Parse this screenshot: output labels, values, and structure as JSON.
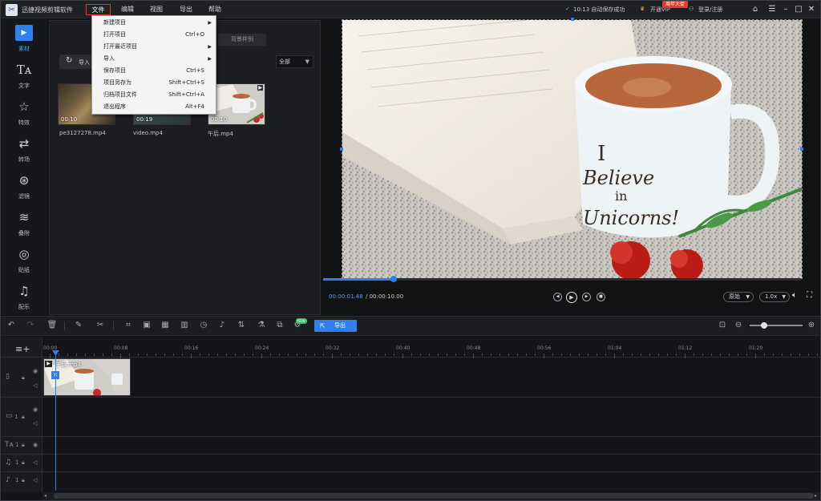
{
  "titlebar": {
    "app_title": "迅捷视频剪辑软件",
    "menu": [
      "文件",
      "编辑",
      "视图",
      "导出",
      "帮助"
    ],
    "autosave": "10:13 自动保存成功",
    "vip_badge": "周年大促",
    "vip_label": "开通VIP",
    "login": "登录/注册"
  },
  "sidebar": [
    {
      "label": "素材",
      "icon": "play-icon"
    },
    {
      "label": "文字",
      "icon": "text-icon"
    },
    {
      "label": "特效",
      "icon": "effects-star-icon"
    },
    {
      "label": "转场",
      "icon": "transition-icon"
    },
    {
      "label": "滤镜",
      "icon": "filter-circles-icon"
    },
    {
      "label": "叠附",
      "icon": "layers-icon"
    },
    {
      "label": "贴纸",
      "icon": "sticker-icon"
    },
    {
      "label": "配乐",
      "icon": "music-note-icon"
    }
  ],
  "material": {
    "bg_tab": "背景样例",
    "import_label": "导入",
    "filter_value": "全部",
    "items": [
      {
        "name": "pe3127278.mp4",
        "duration": "00:10"
      },
      {
        "name": "video.mp4",
        "duration": "00:19"
      },
      {
        "name": "午后.mp4",
        "duration": "00:10"
      }
    ]
  },
  "file_menu": [
    {
      "label": "新建项目",
      "shortcut": "",
      "submenu": true
    },
    {
      "label": "打开项目",
      "shortcut": "Ctrl+O",
      "submenu": false
    },
    {
      "label": "打开最近项目",
      "shortcut": "",
      "submenu": true
    },
    {
      "label": "导入",
      "shortcut": "",
      "submenu": true
    },
    {
      "label": "保存项目",
      "shortcut": "Ctrl+S",
      "submenu": false
    },
    {
      "label": "项目另存为",
      "shortcut": "Shift+Ctrl+S",
      "submenu": false
    },
    {
      "label": "归档项目文件",
      "shortcut": "Shift+Ctrl+A",
      "submenu": false
    },
    {
      "label": "退出程序",
      "shortcut": "Alt+F4",
      "submenu": false
    }
  ],
  "player": {
    "current_time": "00:00:01.48",
    "total_time": "/ 00:00:10.00",
    "progress": 0.148,
    "aspect": "原始",
    "speed": "1.0x"
  },
  "toolbar": {
    "export_label": "导出",
    "new_badge": "NEW",
    "zoom_level": 0.3
  },
  "timeline": {
    "ruler": [
      "00:00",
      "00:08",
      "00:16",
      "00:24",
      "00:32",
      "00:40",
      "00:48",
      "00:56",
      "01:04",
      "01:12",
      "01:20"
    ],
    "clip_name": "午后.mp4",
    "track_index_label": "1"
  },
  "colors": {
    "accent": "#2f80ed",
    "menu_highlight": "#e23a2a",
    "vip": "#e4392d"
  }
}
